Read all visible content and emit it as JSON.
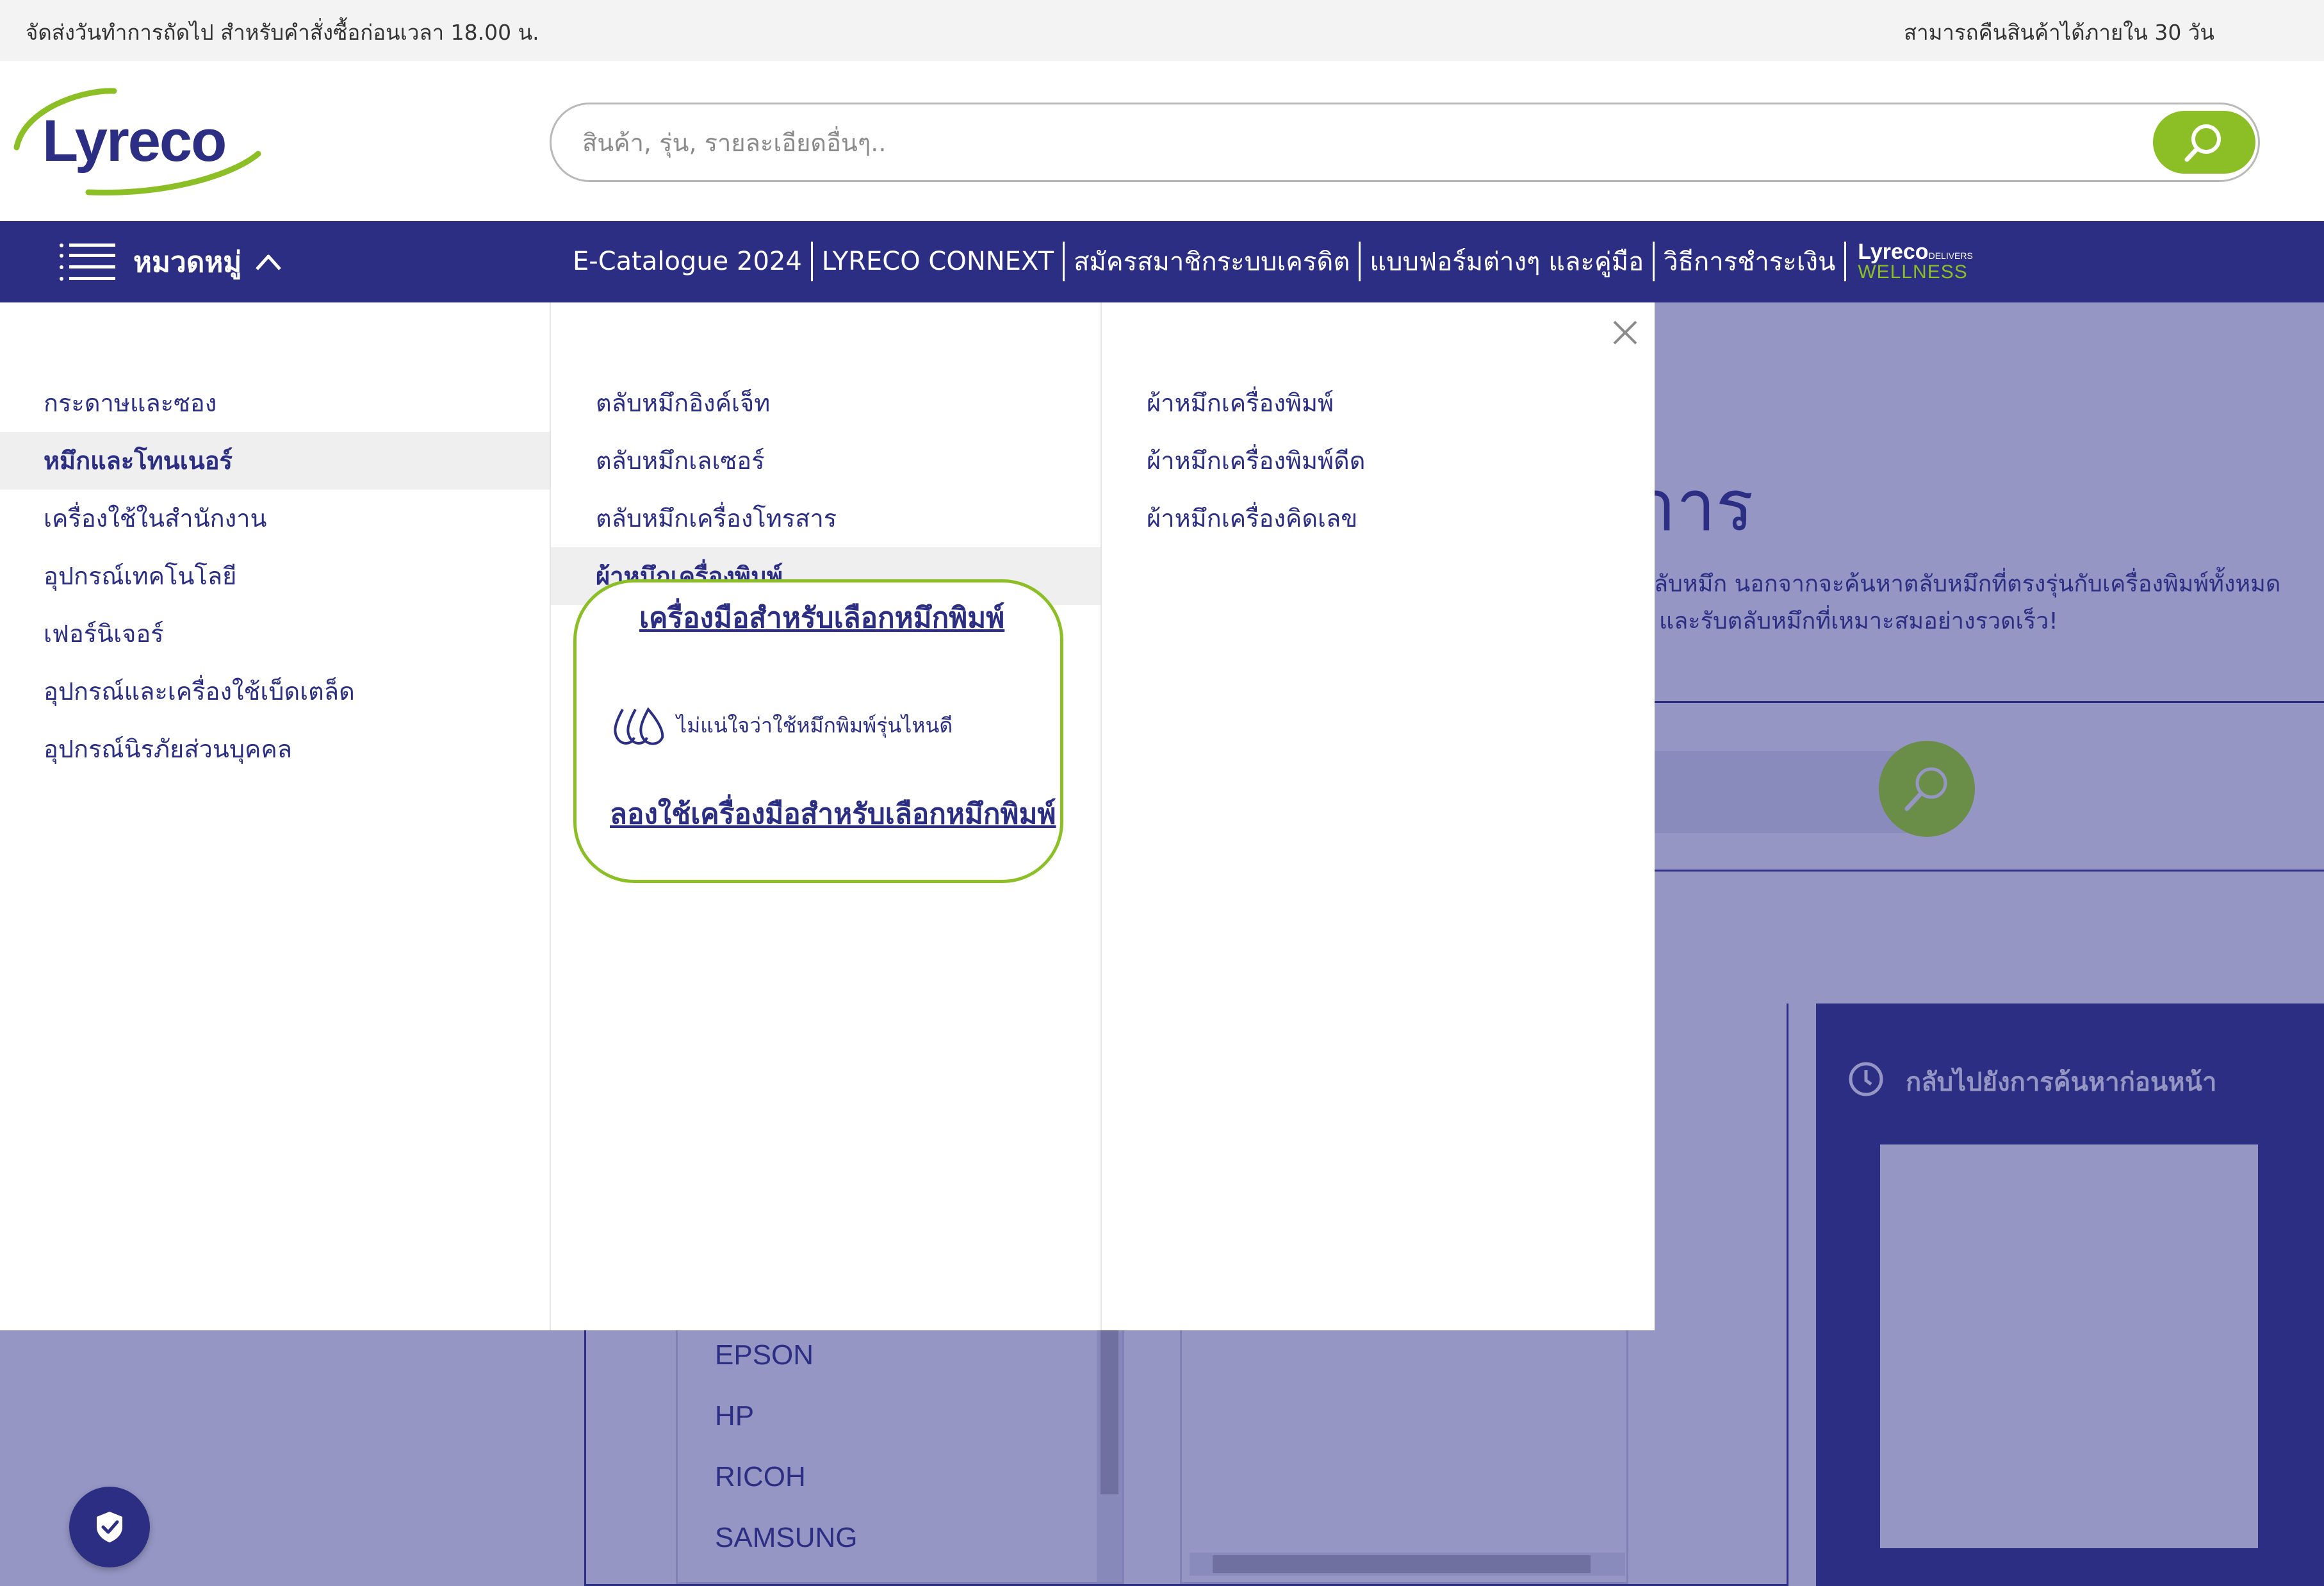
{
  "topbar": {
    "delivery_note": "จัดส่งวันทำการถัดไป สำหรับคำสั่งซื้อก่อนเวลา 18.00 น.",
    "returns_note": "สามารถคืนสินค้าได้ภายใน 30 วัน"
  },
  "header": {
    "logo_text": "Lyreco",
    "search_placeholder": "สินค้า, รุ่น, รายละเอียดอื่นๆ.."
  },
  "nav": {
    "menu_label": "หมวดหมู่",
    "links": [
      "E-Catalogue 2024",
      "LYRECO CONNEXT",
      "สมัครสมาชิกระบบเครดิต",
      "แบบฟอร์มต่างๆ และคู่มือ",
      "วิธีการชำระเงิน"
    ],
    "wellness_brand": "Lyreco",
    "wellness_sub": "DELIVERS",
    "wellness_word": "WELLNESS"
  },
  "mega_menu": {
    "categories": [
      "กระดาษและซอง",
      "หมึกและโทนเนอร์",
      "เครื่องใช้ในสำนักงาน",
      "อุปกรณ์เทคโนโลยี",
      "เฟอร์นิเจอร์",
      "อุปกรณ์และเครื่องใช้เบ็ดเตล็ด",
      "อุปกรณ์นิรภัยส่วนบุคคล"
    ],
    "active_category": "หมึกและโทนเนอร์",
    "subcategories": [
      "ตลับหมึกอิงค์เจ็ท",
      "ตลับหมึกเลเซอร์",
      "ตลับหมึกเครื่องโทรสาร",
      "ผ้าหมึกเครื่องพิมพ์"
    ],
    "active_subcategory": "ผ้าหมึกเครื่องพิมพ์",
    "items": [
      "ผ้าหมึกเครื่องพิมพ์",
      "ผ้าหมึกเครื่องพิมพ์ดีด",
      "ผ้าหมึกเครื่องคิดเลข"
    ],
    "finder": {
      "title": "เครื่องมือสำหรับเลือกหมึกพิมพ์",
      "note": "ไม่แน่ใจว่าใช้หมึกพิมพ์รุ่นไหนดี",
      "cta": "ลองใช้เครื่องมือสำหรับเลือกหมึกพิมพ์"
    }
  },
  "background_page": {
    "heading_fragment": "าาร",
    "desc_line1": "ลับหมึก   นอกจากจะค้นหาตลับหมึกที่ตรงรุ่นกับเครื่องพิมพ์ทั้งหมด",
    "desc_line2": "และรับตลับหมึกที่เหมาะสมอย่างรวดเร็ว!",
    "brands": [
      "EPSON",
      "HP",
      "RICOH",
      "SAMSUNG"
    ],
    "history_title": "กลับไปยังการค้นหาก่อนหน้า"
  },
  "colors": {
    "brand_blue": "#2b2e83",
    "brand_green": "#8cbf26",
    "overlay": "#9596c4"
  }
}
